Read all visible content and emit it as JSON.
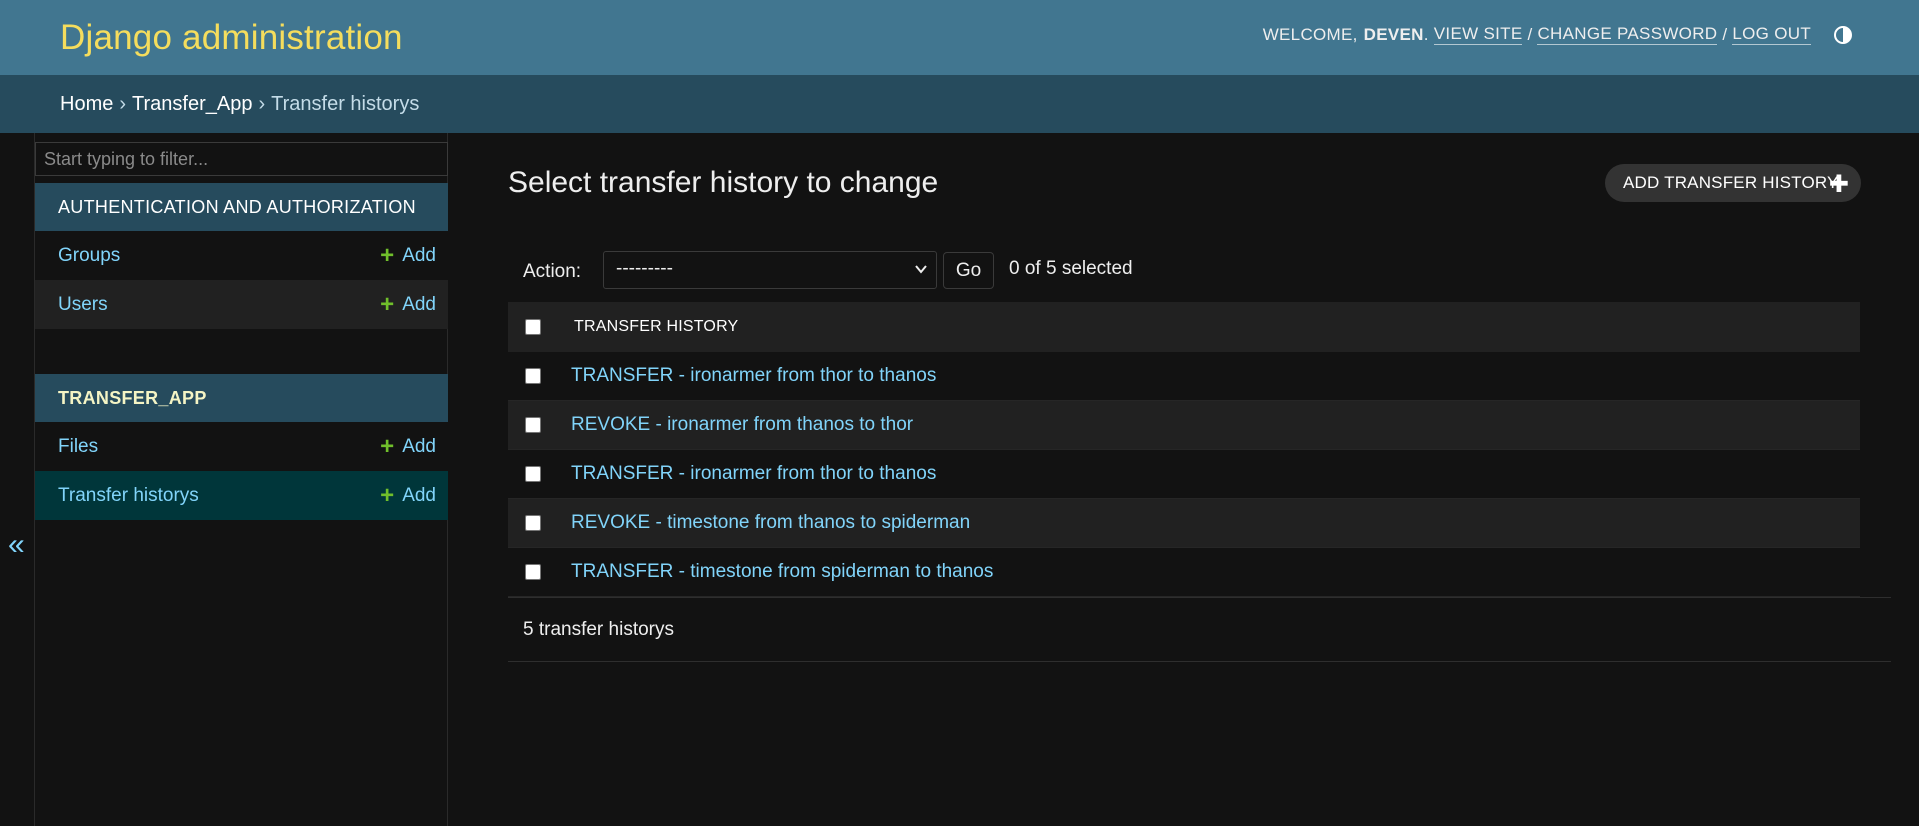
{
  "header": {
    "site_name": "Django administration",
    "welcome": "WELCOME,",
    "username": "DEVEN",
    "view_site": "VIEW SITE",
    "change_password": "CHANGE PASSWORD",
    "log_out": "LOG OUT",
    "separator": "/"
  },
  "breadcrumbs": {
    "items": [
      "Home",
      "Transfer_App",
      "Transfer historys"
    ],
    "separator": "›"
  },
  "sidebar": {
    "filter_placeholder": "Start typing to filter...",
    "apps": [
      {
        "caption": "AUTHENTICATION AND AUTHORIZATION",
        "models": [
          {
            "name": "Groups",
            "add": "Add"
          },
          {
            "name": "Users",
            "add": "Add"
          }
        ]
      },
      {
        "caption": "TRANSFER_APP",
        "models": [
          {
            "name": "Files",
            "add": "Add"
          },
          {
            "name": "Transfer historys",
            "add": "Add"
          }
        ]
      }
    ],
    "collapse_icon": "«"
  },
  "content": {
    "title": "Select transfer history to change",
    "add_button": "ADD TRANSFER HISTORY",
    "action_label": "Action:",
    "action_selected": "---------",
    "go_button": "Go",
    "selected_count": "0 of 5 selected",
    "column_header": "TRANSFER HISTORY",
    "rows": [
      "TRANSFER - ironarmer from thor to thanos",
      "REVOKE - ironarmer from thanos to thor",
      "TRANSFER - ironarmer from thor to thanos",
      "REVOKE - timestone from thanos to spiderman",
      "TRANSFER - timestone from spiderman to thanos"
    ],
    "paginator": "5 transfer historys"
  },
  "colors": {
    "header_bg": "#417690",
    "site_name": "#f5dd5d",
    "breadcrumbs_bg": "#264b5d",
    "link": "#81d4fa",
    "add_plus": "#70bf2b",
    "current_row": "#00363a",
    "page_bg": "#121212"
  }
}
